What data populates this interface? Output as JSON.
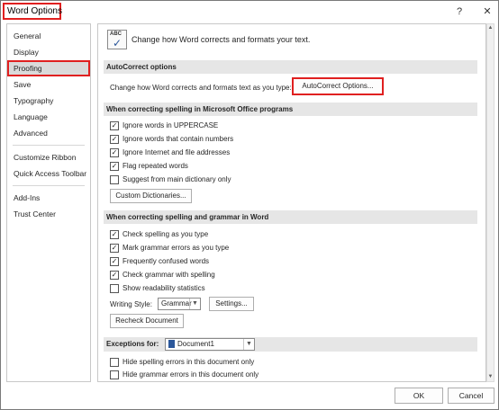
{
  "window": {
    "title": "Word Options",
    "help_glyph": "?",
    "close_glyph": "✕"
  },
  "sidebar": {
    "items": [
      {
        "label": "General"
      },
      {
        "label": "Display"
      },
      {
        "label": "Proofing"
      },
      {
        "label": "Save"
      },
      {
        "label": "Typography"
      },
      {
        "label": "Language"
      },
      {
        "label": "Advanced"
      },
      {
        "label": "Customize Ribbon"
      },
      {
        "label": "Quick Access Toolbar"
      },
      {
        "label": "Add-Ins"
      },
      {
        "label": "Trust Center"
      }
    ]
  },
  "header": {
    "icon_text": "ABC",
    "text": "Change how Word corrects and formats your text."
  },
  "autocorrect": {
    "section_title": "AutoCorrect options",
    "description": "Change how Word corrects and formats text as you type:",
    "button_label": "AutoCorrect Options..."
  },
  "office_spelling": {
    "section_title": "When correcting spelling in Microsoft Office programs",
    "options": [
      {
        "label": "Ignore words in UPPERCASE",
        "checked": true
      },
      {
        "label": "Ignore words that contain numbers",
        "checked": true
      },
      {
        "label": "Ignore Internet and file addresses",
        "checked": true
      },
      {
        "label": "Flag repeated words",
        "checked": true
      },
      {
        "label": "Suggest from main dictionary only",
        "checked": false
      }
    ],
    "button_label": "Custom Dictionaries..."
  },
  "word_spelling": {
    "section_title": "When correcting spelling and grammar in Word",
    "options": [
      {
        "label": "Check spelling as you type",
        "checked": true
      },
      {
        "label": "Mark grammar errors as you type",
        "checked": true
      },
      {
        "label": "Frequently confused words",
        "checked": true
      },
      {
        "label": "Check grammar with spelling",
        "checked": true
      },
      {
        "label": "Show readability statistics",
        "checked": false
      }
    ],
    "writing_style_label": "Writing Style:",
    "writing_style_value": "Grammar",
    "settings_label": "Settings...",
    "recheck_label": "Recheck Document"
  },
  "exceptions": {
    "label": "Exceptions for:",
    "document": "Document1",
    "options": [
      {
        "label": "Hide spelling errors in this document only",
        "checked": false
      },
      {
        "label": "Hide grammar errors in this document only",
        "checked": false
      }
    ]
  },
  "footer": {
    "ok_label": "OK",
    "cancel_label": "Cancel"
  },
  "colors": {
    "highlight": "#e02020",
    "selected_bg": "#dadada",
    "section_bg": "#e6e6e6"
  }
}
